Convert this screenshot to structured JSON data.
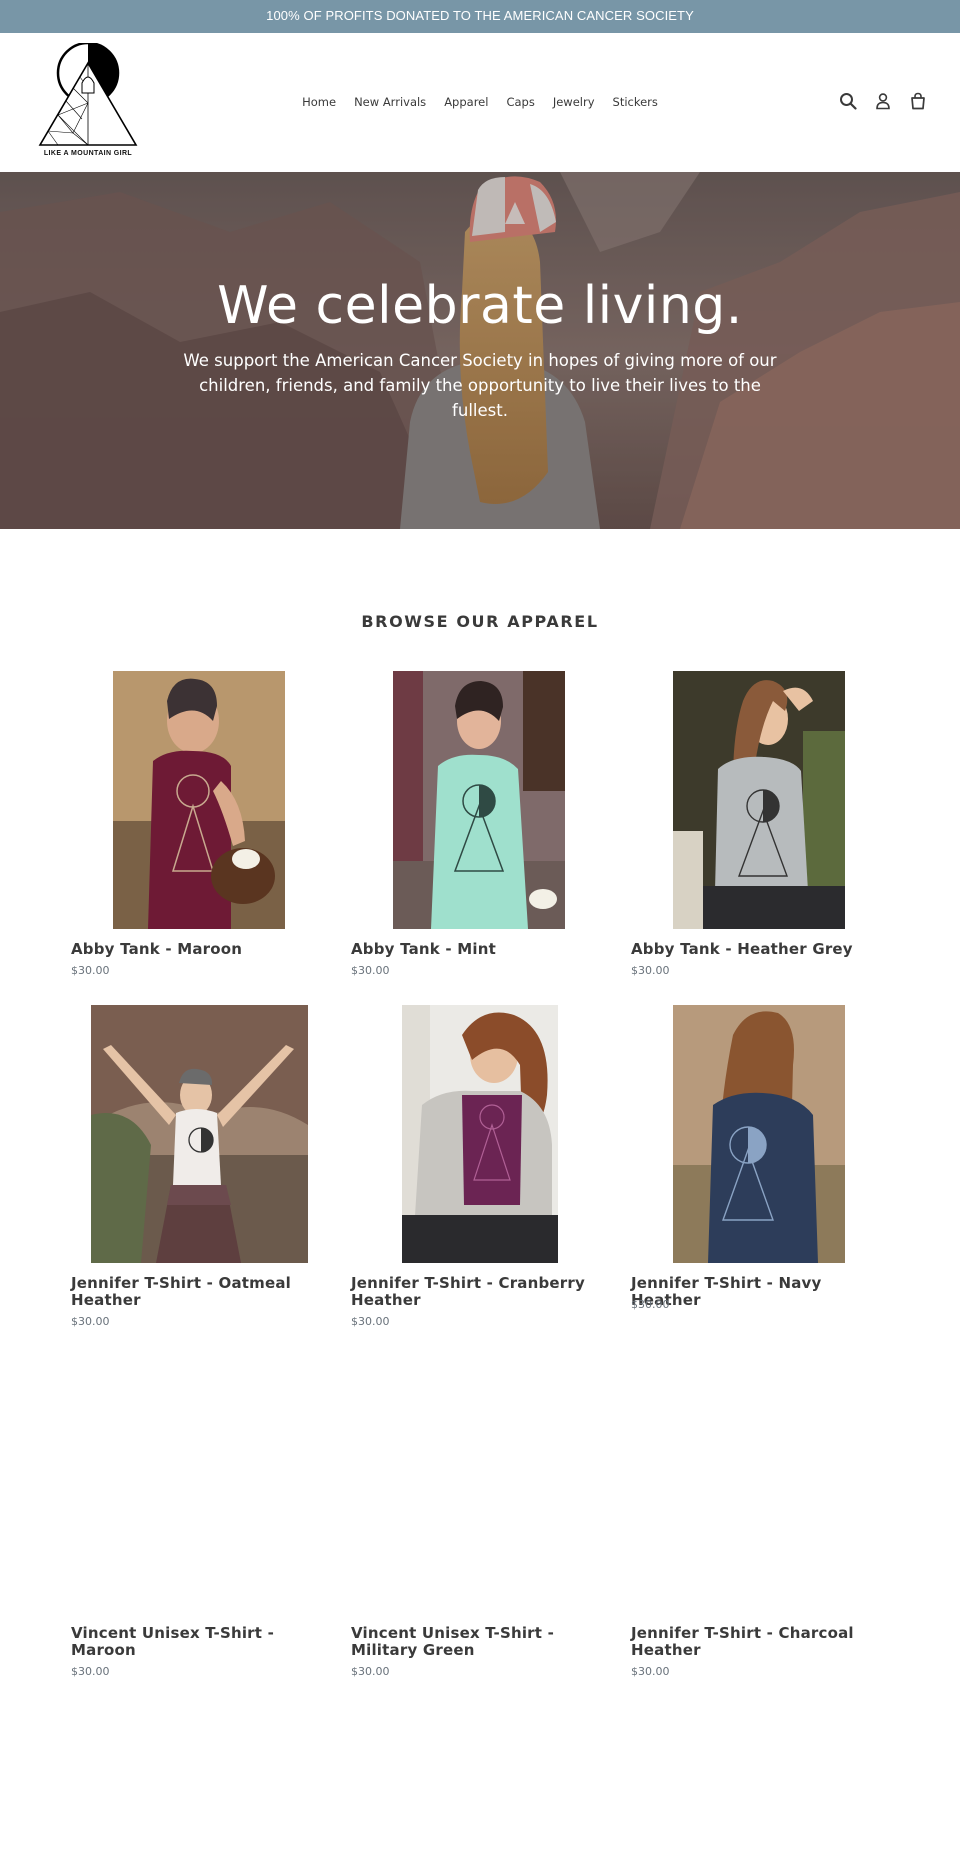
{
  "announcement": "100% OF PROFITS DONATED TO THE AMERICAN CANCER SOCIETY",
  "logo_text": "LIKE A MOUNTAIN GIRL",
  "nav": [
    "Home",
    "New Arrivals",
    "Apparel",
    "Caps",
    "Jewelry",
    "Stickers"
  ],
  "header_icons": [
    "search-icon",
    "account-icon",
    "cart-icon"
  ],
  "hero": {
    "title": "We celebrate living.",
    "subtitle": "We support the American Cancer Society in hopes of giving more of our children, friends, and family the opportunity to live their lives to the fullest."
  },
  "collection": {
    "title": "BROWSE OUR APPAREL",
    "products": [
      {
        "title": "Abby Tank - Maroon",
        "price": "$30.00"
      },
      {
        "title": "Abby Tank - Mint",
        "price": "$30.00"
      },
      {
        "title": "Abby Tank - Heather Grey",
        "price": "$30.00"
      },
      {
        "title": "Jennifer T-Shirt - Oatmeal Heather",
        "price": "$30.00"
      },
      {
        "title": "Jennifer T-Shirt - Cranberry Heather",
        "price": "$30.00"
      },
      {
        "title": "Jennifer T-Shirt - Navy Heather",
        "price": "$30.00"
      },
      {
        "title": "Vincent Unisex T-Shirt - Maroon",
        "price": "$30.00"
      },
      {
        "title": "Vincent Unisex T-Shirt - Military Green",
        "price": "$30.00"
      },
      {
        "title": "Jennifer T-Shirt - Charcoal Heather",
        "price": "$30.00"
      }
    ]
  },
  "colors": {
    "announcement_bg": "#7896a7",
    "text": "#3a3a3a",
    "price": "#69727b"
  }
}
